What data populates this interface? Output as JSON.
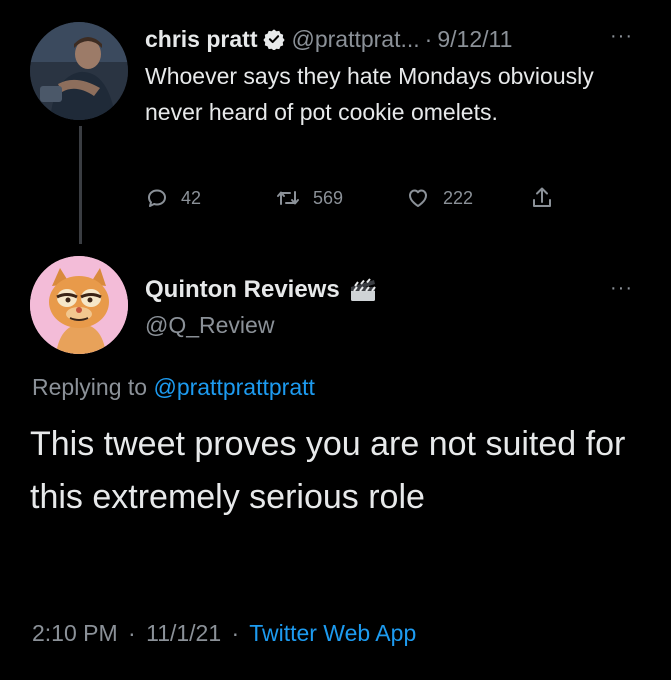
{
  "tweet1": {
    "name": "chris pratt",
    "handle": "@prattprat...",
    "separator": "·",
    "date": "9/12/11",
    "more": "···",
    "text": "Whoever says they hate Mondays obviously never heard of pot cookie omelets.",
    "replies": "42",
    "retweets": "569",
    "likes": "222"
  },
  "tweet2": {
    "name": "Quinton Reviews",
    "handle": "@Q_Review",
    "more": "···",
    "replying_prefix": "Replying to",
    "replying_handle": "@prattprattpratt",
    "text": "This tweet proves you are not suited for this extremely serious role",
    "time": "2:10 PM",
    "date": "11/1/21",
    "separator": "·",
    "source": "Twitter Web App"
  },
  "colors": {
    "background": "#000000",
    "text": "#e7e9ea",
    "muted": "#8b9198",
    "link": "#1d9bf0",
    "thread_line": "#3a3d42"
  },
  "icons": [
    "verified-badge-icon",
    "reply-icon",
    "retweet-icon",
    "like-icon",
    "share-icon",
    "more-icon",
    "clapperboard-icon"
  ]
}
